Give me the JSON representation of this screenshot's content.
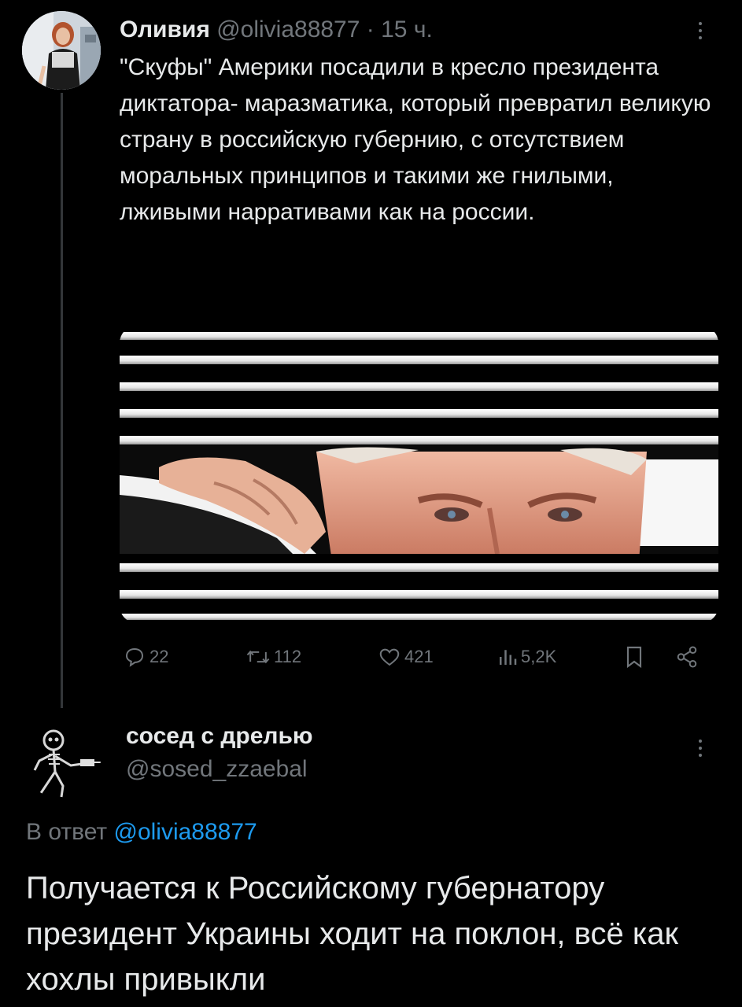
{
  "colors": {
    "background": "#000000",
    "text": "#e7e9ea",
    "muted": "#71767b",
    "link": "#1d9bf0",
    "thread_line": "#333639"
  },
  "post": {
    "author_name": "Оливия",
    "author_handle": "@olivia88877",
    "separator": "·",
    "time": "15 ч.",
    "text": "\"Скуфы\" Америки посадили в кресло президента диктатора- маразматика, который превратил великую страну в российскую губернию, с отсутствием моральных принципов и такими же гнилыми, лживыми нарративами как на россии.",
    "stats": {
      "replies": "22",
      "reposts": "112",
      "likes": "421",
      "views": "5,2K"
    },
    "icons": [
      "reply-icon",
      "repost-icon",
      "like-icon",
      "views-icon",
      "bookmark-icon",
      "share-icon",
      "more-icon"
    ]
  },
  "reply": {
    "author_name": "сосед с дрелью",
    "author_handle": "@sosed_zzaebal",
    "replying_prefix": "В ответ",
    "replying_to": "@olivia88877",
    "text": "Получается к Российскому губернатору президент Украины ходит на поклон, всё как хохлы привыкли",
    "icons": [
      "more-icon"
    ]
  }
}
